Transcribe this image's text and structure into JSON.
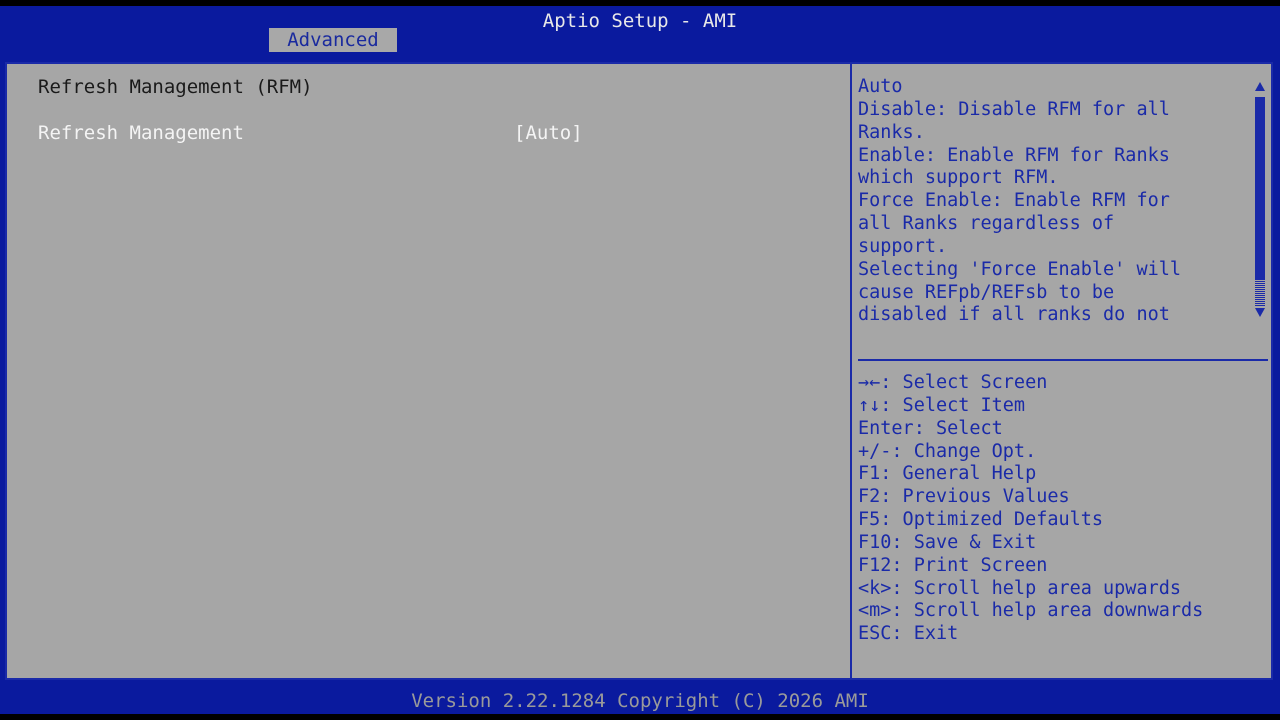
{
  "app": {
    "title": "Aptio Setup - AMI"
  },
  "tabs": [
    {
      "label": "Advanced",
      "active": true
    }
  ],
  "main": {
    "section_title": "Refresh Management (RFM)",
    "items": [
      {
        "label": "Refresh Management",
        "value": "[Auto]",
        "selected": true
      }
    ]
  },
  "help": {
    "lines": [
      "Auto",
      "Disable: Disable RFM for all",
      "Ranks.",
      "Enable: Enable RFM for Ranks",
      "which support RFM.",
      "Force Enable: Enable RFM for",
      "all Ranks regardless of",
      "support.",
      "Selecting 'Force Enable' will",
      "cause REFpb/REFsb to be",
      "disabled if all ranks do not"
    ],
    "scrollbar": {
      "up_icon": "triangle-up",
      "down_icon": "triangle-down"
    }
  },
  "keys": {
    "lines": [
      "→←: Select Screen",
      "↑↓: Select Item",
      "Enter: Select",
      "+/-: Change Opt.",
      "F1: General Help",
      "F2: Previous Values",
      "F5: Optimized Defaults",
      "F10: Save & Exit",
      "F12: Print Screen",
      "<k>: Scroll help area upwards",
      "<m>: Scroll help area downwards",
      "ESC: Exit"
    ]
  },
  "footer": {
    "version": "Version 2.22.1284 Copyright (C) 2026 AMI"
  },
  "colors": {
    "header_bg": "#0a1a9e",
    "panel_bg": "#a6a6a6",
    "help_text": "#1a2aa8",
    "selected_text": "#f4f4f4",
    "tab_bg": "#a8a8a8"
  }
}
